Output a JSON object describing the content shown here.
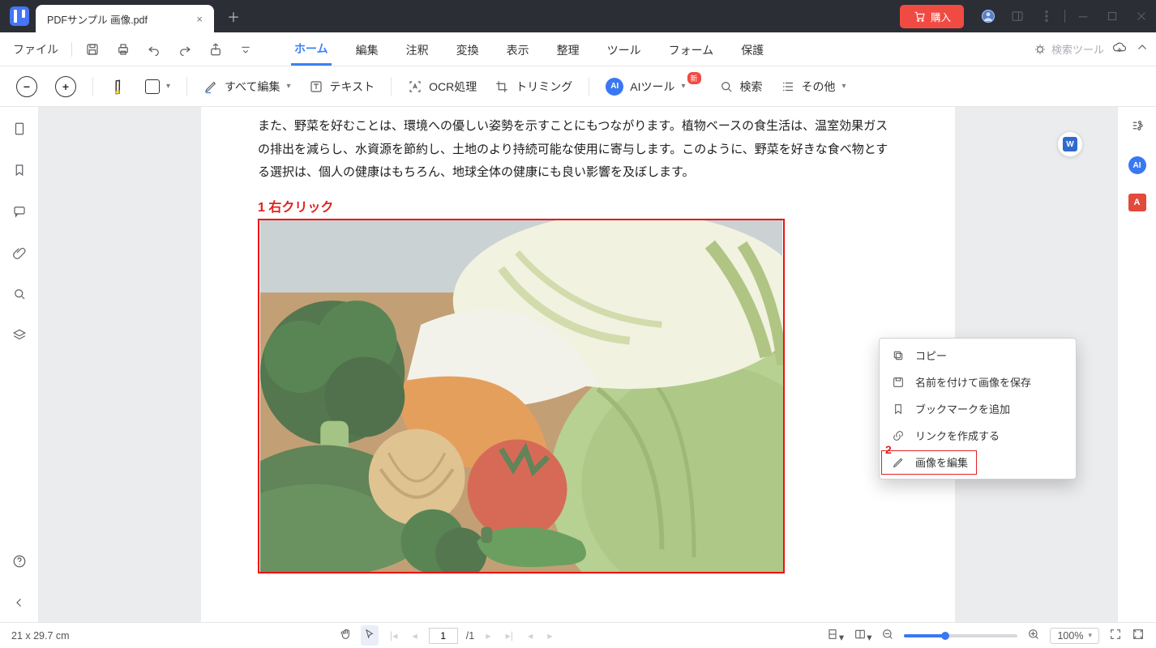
{
  "title": {
    "tab_name": "PDFサンプル 画像.pdf"
  },
  "buy_button": "購入",
  "menu": {
    "file": "ファイル",
    "tabs": [
      "ホーム",
      "編集",
      "注釈",
      "変換",
      "表示",
      "整理",
      "ツール",
      "フォーム",
      "保護"
    ],
    "active_tab_index": 0,
    "search_tool": "検索ツール"
  },
  "toolbar": {
    "edit_all": "すべて編集",
    "text": "テキスト",
    "ocr": "OCR処理",
    "crop": "トリミング",
    "ai": "AIツール",
    "ai_new": "新",
    "search": "検索",
    "more": "その他"
  },
  "body_text": "また、野菜を好むことは、環境への優しい姿勢を示すことにもつながります。植物ベースの食生活は、温室効果ガスの排出を減らし、水資源を節約し、土地のより持続可能な使用に寄与します。このように、野菜を好きな食べ物とする選択は、個人の健康はもちろん、地球全体の健康にも良い影響を及ぼします。",
  "annotation_1": "1 右クリック",
  "annotation_2": "2",
  "context_menu": {
    "items": [
      "コピー",
      "名前を付けて画像を保存",
      "ブックマークを追加",
      "リンクを作成する",
      "画像を編集"
    ],
    "highlighted_index": 4
  },
  "status": {
    "size": "21 x 29.7 cm",
    "page_current": "1",
    "page_total": "/1",
    "zoom": "100%"
  }
}
